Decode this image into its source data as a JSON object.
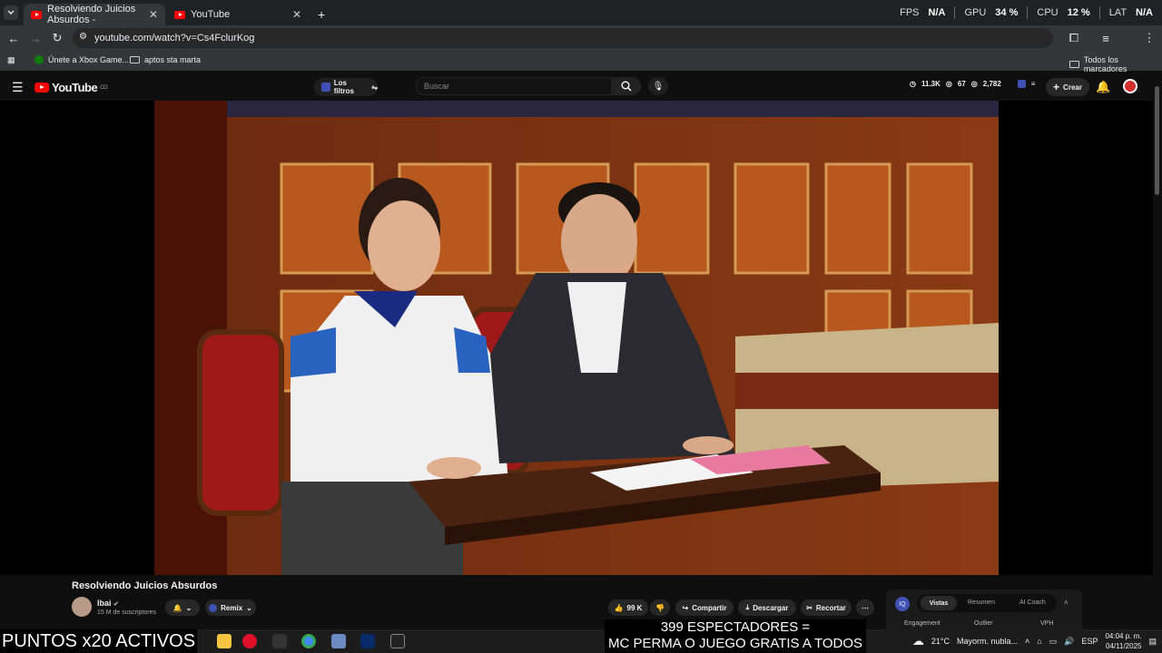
{
  "browser": {
    "tabs": [
      {
        "title": "Resolviendo Juicios Absurdos -",
        "active": true
      },
      {
        "title": "YouTube",
        "active": false
      }
    ],
    "new_tab": "+",
    "url": "youtube.com/watch?v=Cs4FclurKog",
    "perf": {
      "fps_label": "FPS",
      "fps": "N/A",
      "gpu_label": "GPU",
      "gpu": "34 %",
      "cpu_label": "CPU",
      "cpu": "12 %",
      "lat_label": "LAT",
      "lat": "N/A"
    },
    "bookmarks": [
      "Únete a Xbox Game...",
      "aptos sta marta"
    ],
    "all_bookmarks": "Todos los marcadores"
  },
  "youtube": {
    "logo": "YouTube",
    "logo_sup": "CO",
    "filters_label": "Los filtros",
    "search_placeholder": "Buscar",
    "stats": {
      "views": "11.3K",
      "b": "67",
      "c": "2,782"
    },
    "create_label": "Crear"
  },
  "video": {
    "title": "Resolviendo Juicios Absurdos",
    "channel": "Ibai",
    "subscribers": "15 M de suscriptores",
    "remix": "Remix",
    "likes": "99 K",
    "share": "Compartir",
    "download": "Descargar",
    "clip": "Recortar"
  },
  "extension": {
    "tabs": [
      "Vistas",
      "Resumen",
      "AI Coach"
    ],
    "cols": [
      "Engagement",
      "Outlier",
      "VPH"
    ]
  },
  "overlay": {
    "puntos": "PUNTOS x20 ACTIVOS",
    "line1": "399 ESPECTADORES =",
    "line2": "MC PERMA O JUEGO GRATIS A TODOS"
  },
  "taskbar": {
    "weather_temp": "21°C",
    "weather_text": "Mayorm. nubla...",
    "lang": "ESP",
    "time": "04:04 p. m.",
    "date": "04/11/2025"
  }
}
